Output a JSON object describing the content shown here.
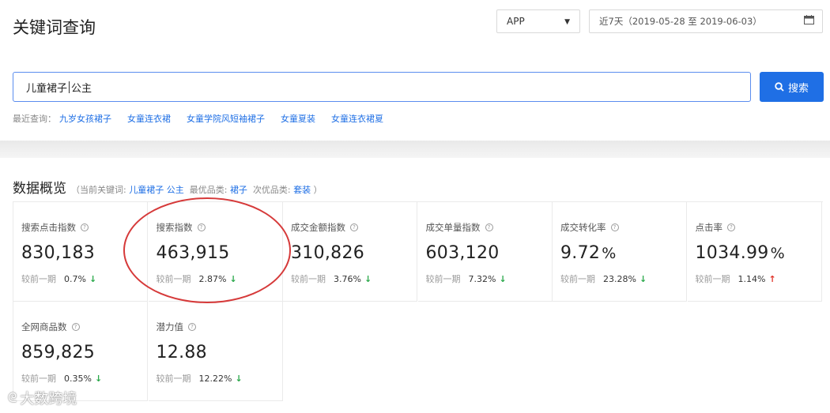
{
  "header": {
    "title": "关键词查询",
    "platform_select": "APP",
    "date_range": "近7天（2019-05-28 至 2019-06-03）"
  },
  "search": {
    "value_before_cursor": "儿童裙子",
    "value_after_cursor": "公主",
    "button_label": "搜索"
  },
  "recent": {
    "label": "最近查询：",
    "items": [
      "九岁女孩裙子",
      "女童连衣裙",
      "女童学院风短袖裙子",
      "女童夏装",
      "女童连衣裙夏"
    ]
  },
  "overview": {
    "title": "数据概览",
    "meta_prefix": "（当前关键词:",
    "current_keyword": "儿童裙子 公主",
    "best_category_label": "最优品类:",
    "best_category": "裙子",
    "second_category_label": "次优品类:",
    "second_category": "套装",
    "meta_suffix": "）",
    "compare_label": "较前一期",
    "cards": [
      {
        "label": "搜索点击指数",
        "value": "830,183",
        "unit": "",
        "change": "0.7%",
        "dir": "down"
      },
      {
        "label": "搜索指数",
        "value": "463,915",
        "unit": "",
        "change": "2.87%",
        "dir": "down"
      },
      {
        "label": "成交金额指数",
        "value": "310,826",
        "unit": "",
        "change": "3.76%",
        "dir": "down"
      },
      {
        "label": "成交单量指数",
        "value": "603,120",
        "unit": "",
        "change": "7.32%",
        "dir": "down"
      },
      {
        "label": "成交转化率",
        "value": "9.72",
        "unit": "%",
        "change": "23.28%",
        "dir": "down"
      },
      {
        "label": "点击率",
        "value": "1034.99",
        "unit": "%",
        "change": "1.14%",
        "dir": "up"
      },
      {
        "label": "全网商品数",
        "value": "859,825",
        "unit": "",
        "change": "0.35%",
        "dir": "down"
      },
      {
        "label": "潜力值",
        "value": "12.88",
        "unit": "",
        "change": "12.22%",
        "dir": "down"
      }
    ]
  },
  "icons": {
    "down": "↓",
    "up": "↑",
    "help": "?"
  },
  "watermark": {
    "text": "大数跨境"
  },
  "colors": {
    "accent": "#1f6fe5",
    "down": "#2aa84a",
    "up": "#e0342a",
    "annotation": "#d63a3a"
  }
}
